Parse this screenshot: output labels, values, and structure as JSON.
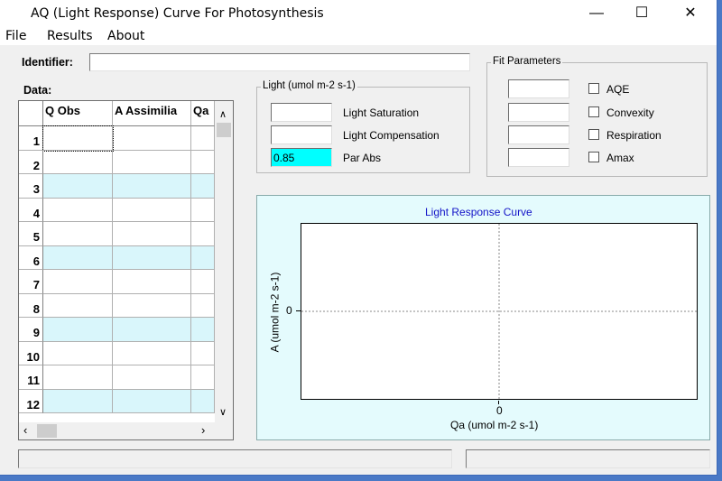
{
  "window": {
    "title": "AQ (Light Response) Curve For Photosynthesis",
    "min_glyph": "—",
    "max_glyph": "☐",
    "close_glyph": "✕"
  },
  "menu": [
    "File",
    "Results",
    "About"
  ],
  "identifier": {
    "label": "Identifier:",
    "value": ""
  },
  "data_label": "Data:",
  "grid": {
    "columns": [
      "Q Obs",
      "A Assimilia",
      "Qa"
    ],
    "rows": [
      "1",
      "2",
      "3",
      "4",
      "5",
      "6",
      "7",
      "8",
      "9",
      "10",
      "11",
      "12"
    ],
    "highlight_rows": [
      3,
      6,
      9,
      12
    ],
    "highlight_color": "#d9f6fb"
  },
  "light_group": {
    "title": "Light (umol m-2 s-1)",
    "fields": [
      {
        "label": "Light Saturation",
        "value": ""
      },
      {
        "label": "Light Compensation",
        "value": ""
      },
      {
        "label": "Par Abs",
        "value": "0.85"
      }
    ]
  },
  "fit_group": {
    "title": "Fit Parameters",
    "params": [
      {
        "label": "AQE",
        "value": "",
        "checked": false
      },
      {
        "label": "Convexity",
        "value": "",
        "checked": false
      },
      {
        "label": "Respiration",
        "value": "",
        "checked": false
      },
      {
        "label": "Amax",
        "value": "",
        "checked": false
      }
    ]
  },
  "chart_data": {
    "type": "line",
    "title": "Light Response Curve",
    "xlabel": "Qa (umol m-2 s-1)",
    "ylabel": "A (umol m-2 s-1)",
    "x_ticks": [
      "0"
    ],
    "y_ticks": [
      "0"
    ],
    "series": [],
    "grid": true,
    "title_color": "#1414c8"
  },
  "colors": {
    "cyan_field": "#00ffff",
    "plot_bg": "#e4fbfd"
  }
}
